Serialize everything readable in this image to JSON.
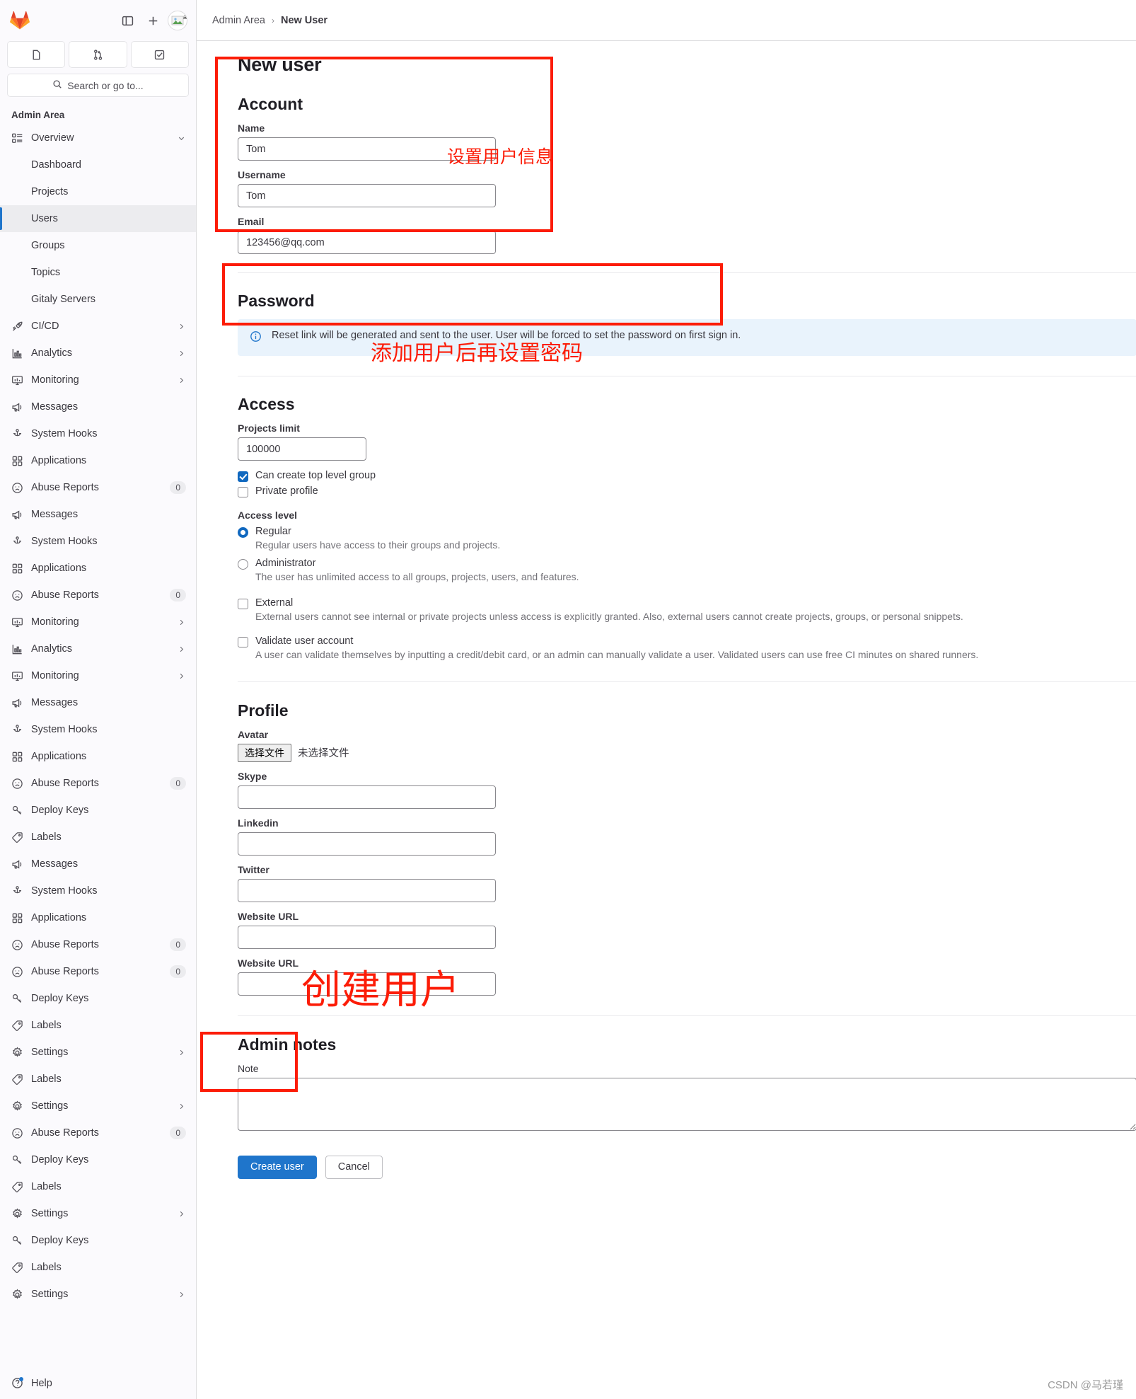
{
  "sidebar": {
    "brand": "gitlab-logo",
    "top_icons": [
      {
        "name": "sidebar-toggle-icon",
        "label": "Toggle sidebar"
      },
      {
        "name": "plus-icon",
        "label": "Create new"
      },
      {
        "name": "user-avatar",
        "label": "a"
      }
    ],
    "tabs": [
      {
        "name": "issues-icon",
        "label": "Issues"
      },
      {
        "name": "merge-requests-icon",
        "label": "Merge requests"
      },
      {
        "name": "todos-icon",
        "label": "To-Do list"
      }
    ],
    "search_placeholder": "Search or go to...",
    "heading": "Admin Area",
    "items": [
      {
        "label": "Overview",
        "icon": "overview-icon",
        "chevron": "v",
        "active": false,
        "sub": false,
        "badge": ""
      },
      {
        "label": "Dashboard",
        "icon": "",
        "chevron": "",
        "active": false,
        "sub": true,
        "badge": ""
      },
      {
        "label": "Projects",
        "icon": "",
        "chevron": "",
        "active": false,
        "sub": true,
        "badge": ""
      },
      {
        "label": "Users",
        "icon": "",
        "chevron": "",
        "active": true,
        "sub": true,
        "badge": ""
      },
      {
        "label": "Groups",
        "icon": "",
        "chevron": "",
        "active": false,
        "sub": true,
        "badge": ""
      },
      {
        "label": "Topics",
        "icon": "",
        "chevron": "",
        "active": false,
        "sub": true,
        "badge": ""
      },
      {
        "label": "Gitaly Servers",
        "icon": "",
        "chevron": "",
        "active": false,
        "sub": true,
        "badge": ""
      },
      {
        "label": "CI/CD",
        "icon": "rocket-icon",
        "chevron": ">",
        "active": false,
        "sub": false,
        "badge": ""
      },
      {
        "label": "Analytics",
        "icon": "analytics-icon",
        "chevron": ">",
        "active": false,
        "sub": false,
        "badge": ""
      },
      {
        "label": "Monitoring",
        "icon": "monitor-icon",
        "chevron": ">",
        "active": false,
        "sub": false,
        "badge": ""
      },
      {
        "label": "Messages",
        "icon": "megaphone-icon",
        "chevron": "",
        "active": false,
        "sub": false,
        "badge": ""
      },
      {
        "label": "System Hooks",
        "icon": "hook-icon",
        "chevron": "",
        "active": false,
        "sub": false,
        "badge": ""
      },
      {
        "label": "Applications",
        "icon": "applications-icon",
        "chevron": "",
        "active": false,
        "sub": false,
        "badge": ""
      },
      {
        "label": "Abuse Reports",
        "icon": "abuse-icon",
        "chevron": "",
        "active": false,
        "sub": false,
        "badge": "0"
      },
      {
        "label": "Messages",
        "icon": "megaphone-icon",
        "chevron": "",
        "active": false,
        "sub": false,
        "badge": ""
      },
      {
        "label": "System Hooks",
        "icon": "hook-icon",
        "chevron": "",
        "active": false,
        "sub": false,
        "badge": ""
      },
      {
        "label": "Applications",
        "icon": "applications-icon",
        "chevron": "",
        "active": false,
        "sub": false,
        "badge": ""
      },
      {
        "label": "Abuse Reports",
        "icon": "abuse-icon",
        "chevron": "",
        "active": false,
        "sub": false,
        "badge": "0"
      },
      {
        "label": "Monitoring",
        "icon": "monitor-icon",
        "chevron": ">",
        "active": false,
        "sub": false,
        "badge": ""
      },
      {
        "label": "Analytics",
        "icon": "analytics-icon",
        "chevron": ">",
        "active": false,
        "sub": false,
        "badge": ""
      },
      {
        "label": "Monitoring",
        "icon": "monitor-icon",
        "chevron": ">",
        "active": false,
        "sub": false,
        "badge": ""
      },
      {
        "label": "Messages",
        "icon": "megaphone-icon",
        "chevron": "",
        "active": false,
        "sub": false,
        "badge": ""
      },
      {
        "label": "System Hooks",
        "icon": "hook-icon",
        "chevron": "",
        "active": false,
        "sub": false,
        "badge": ""
      },
      {
        "label": "Applications",
        "icon": "applications-icon",
        "chevron": "",
        "active": false,
        "sub": false,
        "badge": ""
      },
      {
        "label": "Abuse Reports",
        "icon": "abuse-icon",
        "chevron": "",
        "active": false,
        "sub": false,
        "badge": "0"
      },
      {
        "label": "Deploy Keys",
        "icon": "key-icon",
        "chevron": "",
        "active": false,
        "sub": false,
        "badge": ""
      },
      {
        "label": "Labels",
        "icon": "label-icon",
        "chevron": "",
        "active": false,
        "sub": false,
        "badge": ""
      },
      {
        "label": "Messages",
        "icon": "megaphone-icon",
        "chevron": "",
        "active": false,
        "sub": false,
        "badge": ""
      },
      {
        "label": "System Hooks",
        "icon": "hook-icon",
        "chevron": "",
        "active": false,
        "sub": false,
        "badge": ""
      },
      {
        "label": "Applications",
        "icon": "applications-icon",
        "chevron": "",
        "active": false,
        "sub": false,
        "badge": ""
      },
      {
        "label": "Abuse Reports",
        "icon": "abuse-icon",
        "chevron": "",
        "active": false,
        "sub": false,
        "badge": "0"
      },
      {
        "label": "Abuse Reports",
        "icon": "abuse-icon",
        "chevron": "",
        "active": false,
        "sub": false,
        "badge": "0"
      },
      {
        "label": "Deploy Keys",
        "icon": "key-icon",
        "chevron": "",
        "active": false,
        "sub": false,
        "badge": ""
      },
      {
        "label": "Labels",
        "icon": "label-icon",
        "chevron": "",
        "active": false,
        "sub": false,
        "badge": ""
      },
      {
        "label": "Settings",
        "icon": "gear-icon",
        "chevron": ">",
        "active": false,
        "sub": false,
        "badge": ""
      },
      {
        "label": "Labels",
        "icon": "label-icon",
        "chevron": "",
        "active": false,
        "sub": false,
        "badge": ""
      },
      {
        "label": "Settings",
        "icon": "gear-icon",
        "chevron": ">",
        "active": false,
        "sub": false,
        "badge": ""
      },
      {
        "label": "Abuse Reports",
        "icon": "abuse-icon",
        "chevron": "",
        "active": false,
        "sub": false,
        "badge": "0"
      },
      {
        "label": "Deploy Keys",
        "icon": "key-icon",
        "chevron": "",
        "active": false,
        "sub": false,
        "badge": ""
      },
      {
        "label": "Labels",
        "icon": "label-icon",
        "chevron": "",
        "active": false,
        "sub": false,
        "badge": ""
      },
      {
        "label": "Settings",
        "icon": "gear-icon",
        "chevron": ">",
        "active": false,
        "sub": false,
        "badge": ""
      },
      {
        "label": "Deploy Keys",
        "icon": "key-icon",
        "chevron": "",
        "active": false,
        "sub": false,
        "badge": ""
      },
      {
        "label": "Labels",
        "icon": "label-icon",
        "chevron": "",
        "active": false,
        "sub": false,
        "badge": ""
      },
      {
        "label": "Settings",
        "icon": "gear-icon",
        "chevron": ">",
        "active": false,
        "sub": false,
        "badge": ""
      }
    ],
    "help_label": "Help"
  },
  "breadcrumb": {
    "parent": "Admin Area",
    "separator": "›",
    "current": "New User"
  },
  "page": {
    "title": "New user"
  },
  "account": {
    "section_title": "Account",
    "name_label": "Name",
    "name_value": "Tom",
    "username_label": "Username",
    "username_value": "Tom",
    "email_label": "Email",
    "email_value": "123456@qq.com"
  },
  "password": {
    "section_title": "Password",
    "info_icon": "info-circle-icon",
    "info_text": "Reset link will be generated and sent to the user. User will be forced to set the password on first sign in."
  },
  "access": {
    "section_title": "Access",
    "projects_limit_label": "Projects limit",
    "projects_limit_value": "100000",
    "can_create_top_level_group": {
      "label": "Can create top level group",
      "checked": true
    },
    "private_profile": {
      "label": "Private profile",
      "checked": false
    },
    "access_level_label": "Access level",
    "levels": [
      {
        "label": "Regular",
        "description": "Regular users have access to their groups and projects.",
        "selected": true
      },
      {
        "label": "Administrator",
        "description": "The user has unlimited access to all groups, projects, users, and features.",
        "selected": false
      }
    ],
    "external": {
      "label": "External",
      "description": "External users cannot see internal or private projects unless access is explicitly granted. Also, external users cannot create projects, groups, or personal snippets.",
      "checked": false
    },
    "validate": {
      "label": "Validate user account",
      "description": "A user can validate themselves by inputting a credit/debit card, or an admin can manually validate a user. Validated users can use free CI minutes on shared runners.",
      "checked": false
    }
  },
  "profile": {
    "section_title": "Profile",
    "avatar_label": "Avatar",
    "file_button": "选择文件",
    "file_status": "未选择文件",
    "fields": [
      {
        "label": "Skype",
        "value": ""
      },
      {
        "label": "Linkedin",
        "value": ""
      },
      {
        "label": "Twitter",
        "value": ""
      },
      {
        "label": "Website URL",
        "value": ""
      },
      {
        "label": "Website URL",
        "value": ""
      }
    ]
  },
  "admin_notes": {
    "section_title": "Admin notes",
    "note_label": "Note",
    "note_value": ""
  },
  "actions": {
    "create_label": "Create user",
    "cancel_label": "Cancel"
  },
  "annotations": [
    {
      "text": "设置用户信息"
    },
    {
      "text": "添加用户后再设置密码"
    },
    {
      "text": "创建用户"
    }
  ],
  "watermark": "CSDN @马若瑾"
}
